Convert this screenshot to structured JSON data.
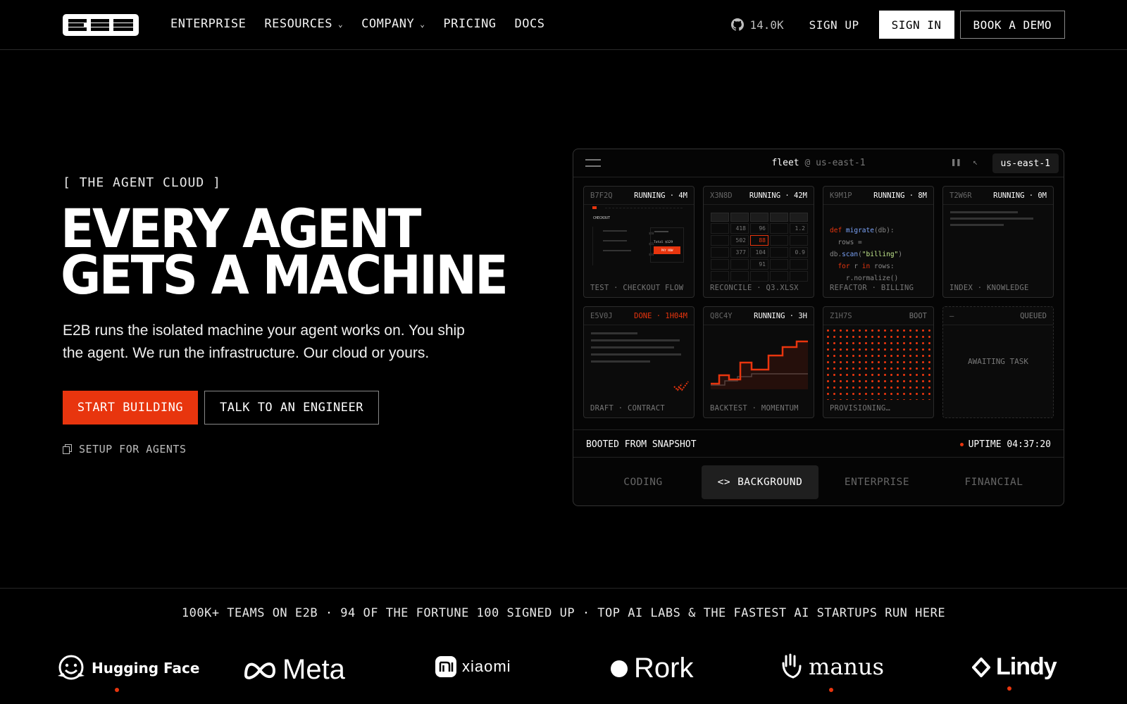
{
  "nav": {
    "logo_text": "E2B",
    "links": [
      {
        "label": "ENTERPRISE",
        "dropdown": false
      },
      {
        "label": "RESOURCES",
        "dropdown": true
      },
      {
        "label": "COMPANY",
        "dropdown": true
      },
      {
        "label": "PRICING",
        "dropdown": false
      },
      {
        "label": "DOCS",
        "dropdown": false
      }
    ],
    "github_stars": "14.0K",
    "signup_label": "SIGN UP",
    "signin_label": "SIGN IN",
    "demo_label": "BOOK A DEMO"
  },
  "hero": {
    "eyebrow": "[ THE AGENT CLOUD ]",
    "headline_line1": "EVERY AGENT",
    "headline_line2": "GETS A MACHINE",
    "subtext": "E2B runs the isolated machine your agent works on. You ship the agent. We run the infrastructure. Our cloud or yours.",
    "cta_primary": "START BUILDING",
    "cta_secondary": "TALK TO AN ENGINEER",
    "setup_label": "SETUP FOR AGENTS"
  },
  "fleet": {
    "title": "fleet",
    "at_region": "@ us-east-1",
    "region_badge": "us-east-1",
    "cards": [
      {
        "id": "B7F2Q",
        "status": "RUNNING · 4M",
        "footer": "TEST · CHECKOUT FLOW"
      },
      {
        "id": "X3N8D",
        "status": "RUNNING · 42M",
        "footer": "RECONCILE · Q3.XLSX"
      },
      {
        "id": "K9M1P",
        "status": "RUNNING · 8M",
        "footer": "REFACTOR · BILLING"
      },
      {
        "id": "T2W6R",
        "status": "RUNNING · 0M",
        "footer": "INDEX · KNOWLEDGE"
      },
      {
        "id": "E5V0J",
        "status": "DONE · 1H04M",
        "footer": "DRAFT · CONTRACT"
      },
      {
        "id": "Q8C4Y",
        "status": "RUNNING · 3H",
        "footer": "BACKTEST · MOMENTUM"
      },
      {
        "id": "Z1H7S",
        "status": "BOOT",
        "footer": "PROVISIONING…"
      },
      {
        "id": "—",
        "status": "QUEUED",
        "footer": "",
        "body": "AWAITING TASK"
      }
    ],
    "checkout": {
      "title": "CHECKOUT",
      "total": "Total $129",
      "pay": "PAY NOW"
    },
    "sheet_cells": [
      "418",
      "96",
      "1.2",
      "502",
      "88",
      "377",
      "104",
      "0.9",
      "91"
    ],
    "code": {
      "l1_kw": "def",
      "l1_fn": "migrate",
      "l1_rest": "(db):",
      "l2": "rows =",
      "l3_a": "db.",
      "l3_fn": "scan",
      "l3_b": "(",
      "l3_str": "\"billing\"",
      "l3_c": ")",
      "l4_kw": "for",
      "l4_a": " r ",
      "l4_kw2": "in",
      "l4_b": " rows:",
      "l5": "r.normalize()"
    },
    "boot_label": "BOOTED FROM SNAPSHOT",
    "uptime": "UPTIME 04:37:20",
    "tabs": [
      {
        "label": "CODING",
        "active": false
      },
      {
        "label": "BACKGROUND",
        "active": true
      },
      {
        "label": "ENTERPRISE",
        "active": false
      },
      {
        "label": "FINANCIAL",
        "active": false
      }
    ],
    "active_tab_icon": "<>",
    "accent": "#e8350e"
  },
  "social_proof": "100K+ TEAMS ON E2B · 94 OF THE FORTUNE 100 SIGNED UP · TOP AI LABS & THE FASTEST AI STARTUPS RUN HERE",
  "logos": [
    {
      "name": "Hugging Face",
      "icon": "hugging-face-icon"
    },
    {
      "name": "Meta",
      "icon": "meta-icon"
    },
    {
      "name": "xiaomi",
      "icon": "xiaomi-icon"
    },
    {
      "name": "Rork",
      "icon": "rork-icon"
    },
    {
      "name": "manus",
      "icon": "manus-icon"
    },
    {
      "name": "Lindy",
      "icon": "lindy-icon"
    }
  ]
}
